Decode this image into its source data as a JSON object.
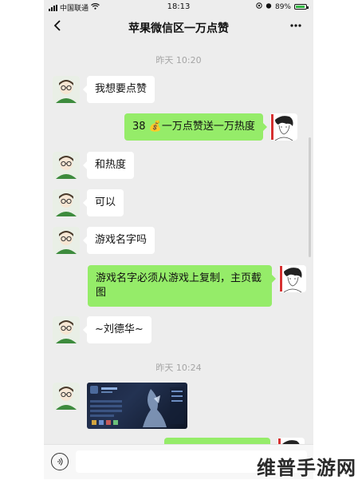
{
  "status_bar": {
    "carrier": "中国联通",
    "time": "18:13",
    "battery": "89%",
    "battery_level": 0.89,
    "wifi_icon": "wifi-icon",
    "alarm_icon": "alarm-icon"
  },
  "nav": {
    "back_icon": "chevron-left-icon",
    "title": "苹果微信区一万点赞",
    "more_icon": "more-icon"
  },
  "timestamps": [
    "昨天 10:20",
    "昨天 10:24"
  ],
  "messages": [
    {
      "side": "in",
      "text": "我想要点赞"
    },
    {
      "side": "out",
      "text": "38 💰一万点赞送一万热度"
    },
    {
      "side": "in",
      "text": "和热度"
    },
    {
      "side": "in",
      "text": "可以"
    },
    {
      "side": "in",
      "text": "游戏名字吗"
    },
    {
      "side": "out",
      "text": "游戏名字必须从游戏上复制，主页截图"
    },
    {
      "side": "in",
      "text": "~刘德华~"
    },
    {
      "side": "in",
      "type": "image"
    }
  ],
  "input": {
    "voice_icon": "voice-icon"
  },
  "watermark": "维普手游网",
  "colors": {
    "bubble_out": "#95ec69",
    "bubble_in": "#ffffff",
    "background": "#ededed"
  }
}
